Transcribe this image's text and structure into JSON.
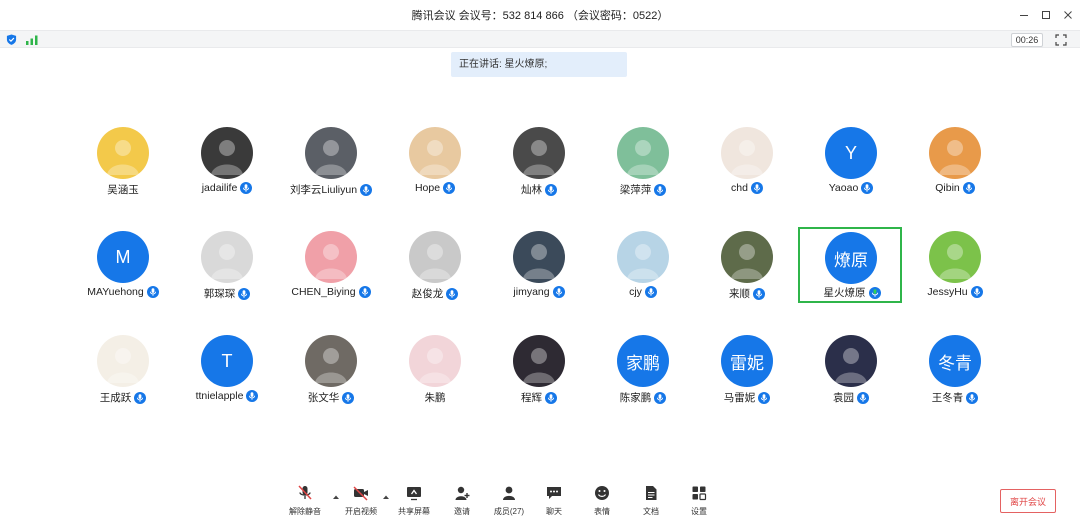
{
  "window": {
    "title": "腾讯会议 会议号：532 814 866 （会议密码：0522）"
  },
  "status": {
    "timer": "00:26"
  },
  "speaking_banner": "正在讲话: 星火燎原;",
  "participants": [
    {
      "name": "吴涵玉",
      "avatar": "photo",
      "color": "#f3c94a",
      "mic": false
    },
    {
      "name": "jadailife",
      "avatar": "photo",
      "color": "#3a3a3a",
      "mic": true
    },
    {
      "name": "刘李云Liuliyun",
      "avatar": "photo",
      "color": "#5b5f66",
      "mic": true
    },
    {
      "name": "Hope",
      "avatar": "photo",
      "color": "#e8c9a0",
      "mic": true
    },
    {
      "name": "灿林",
      "avatar": "photo",
      "color": "#4a4a4a",
      "mic": true
    },
    {
      "name": "梁萍萍",
      "avatar": "photo",
      "color": "#7fbf9a",
      "mic": true
    },
    {
      "name": "chd",
      "avatar": "photo",
      "color": "#f0e6de",
      "mic": true
    },
    {
      "name": "Yaoao",
      "avatar": "Y",
      "color": "#1677e8",
      "mic": true
    },
    {
      "name": "Qibin",
      "avatar": "photo",
      "color": "#e89a4a",
      "mic": true
    },
    {
      "name": "MAYuehong",
      "avatar": "M",
      "color": "#1677e8",
      "mic": true
    },
    {
      "name": "郭琛琛",
      "avatar": "photo",
      "color": "#d9d9d9",
      "mic": true
    },
    {
      "name": "CHEN_Biying",
      "avatar": "photo",
      "color": "#f0a0a8",
      "mic": true
    },
    {
      "name": "赵俊龙",
      "avatar": "photo",
      "color": "#c9c9c9",
      "mic": true
    },
    {
      "name": "jimyang",
      "avatar": "photo",
      "color": "#3b4a5a",
      "mic": true
    },
    {
      "name": "cjy",
      "avatar": "photo",
      "color": "#b7d4e6",
      "mic": true
    },
    {
      "name": "来顺",
      "avatar": "photo",
      "color": "#5e6b4a",
      "mic": true
    },
    {
      "name": "星火燎原",
      "avatar": "燎原",
      "color": "#1677e8",
      "mic": true,
      "active": true
    },
    {
      "name": "JessyHu",
      "avatar": "photo",
      "color": "#7cc24a",
      "mic": true
    },
    {
      "name": "王成跃",
      "avatar": "photo",
      "color": "#f4efe6",
      "mic": true
    },
    {
      "name": "ttnielapple",
      "avatar": "T",
      "color": "#1677e8",
      "mic": true
    },
    {
      "name": "张文华",
      "avatar": "photo",
      "color": "#6f6a64",
      "mic": true
    },
    {
      "name": "朱鹏",
      "avatar": "photo",
      "color": "#f2d5d9",
      "mic": false
    },
    {
      "name": "程辉",
      "avatar": "photo",
      "color": "#2e2a33",
      "mic": true
    },
    {
      "name": "陈家鹏",
      "avatar": "家鹏",
      "color": "#1677e8",
      "mic": true
    },
    {
      "name": "马雷妮",
      "avatar": "雷妮",
      "color": "#1677e8",
      "mic": true
    },
    {
      "name": "袁园",
      "avatar": "photo",
      "color": "#2b2f4a",
      "mic": true
    },
    {
      "name": "王冬青",
      "avatar": "冬青",
      "color": "#1677e8",
      "mic": true
    }
  ],
  "toolbar": {
    "unmute": "解除静音",
    "start_video": "开启视频",
    "share_screen": "共享屏幕",
    "invite": "邀请",
    "members": "成员(27)",
    "chat": "聊天",
    "reactions": "表情",
    "docs": "文档",
    "settings": "设置",
    "leave": "离开会议"
  },
  "colors": {
    "accent": "#1677e8",
    "active_border": "#2fb54a",
    "leave": "#e04545",
    "banner": "#e3eefb"
  }
}
